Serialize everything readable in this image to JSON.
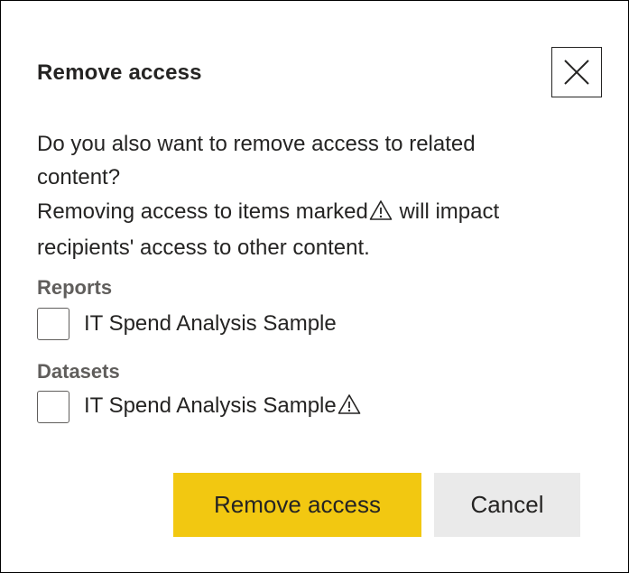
{
  "dialog": {
    "title": "Remove access",
    "close_icon": "close-icon",
    "message_line1": "Do you also want to remove access to related content?",
    "message_line2_before": "Removing access to items marked",
    "message_line2_after": " will impact recipients' access to other content.",
    "warning_icon": "warning-icon"
  },
  "sections": [
    {
      "heading": "Reports",
      "items": [
        {
          "label": "IT Spend Analysis Sample",
          "checked": false,
          "warning": false
        }
      ]
    },
    {
      "heading": "Datasets",
      "items": [
        {
          "label": "IT Spend Analysis Sample",
          "checked": false,
          "warning": true
        }
      ]
    }
  ],
  "buttons": {
    "primary_label": "Remove access",
    "secondary_label": "Cancel"
  },
  "colors": {
    "primary_button": "#f2c811",
    "secondary_button": "#eaeaea",
    "text": "#252423",
    "section_heading": "#605e5c"
  }
}
